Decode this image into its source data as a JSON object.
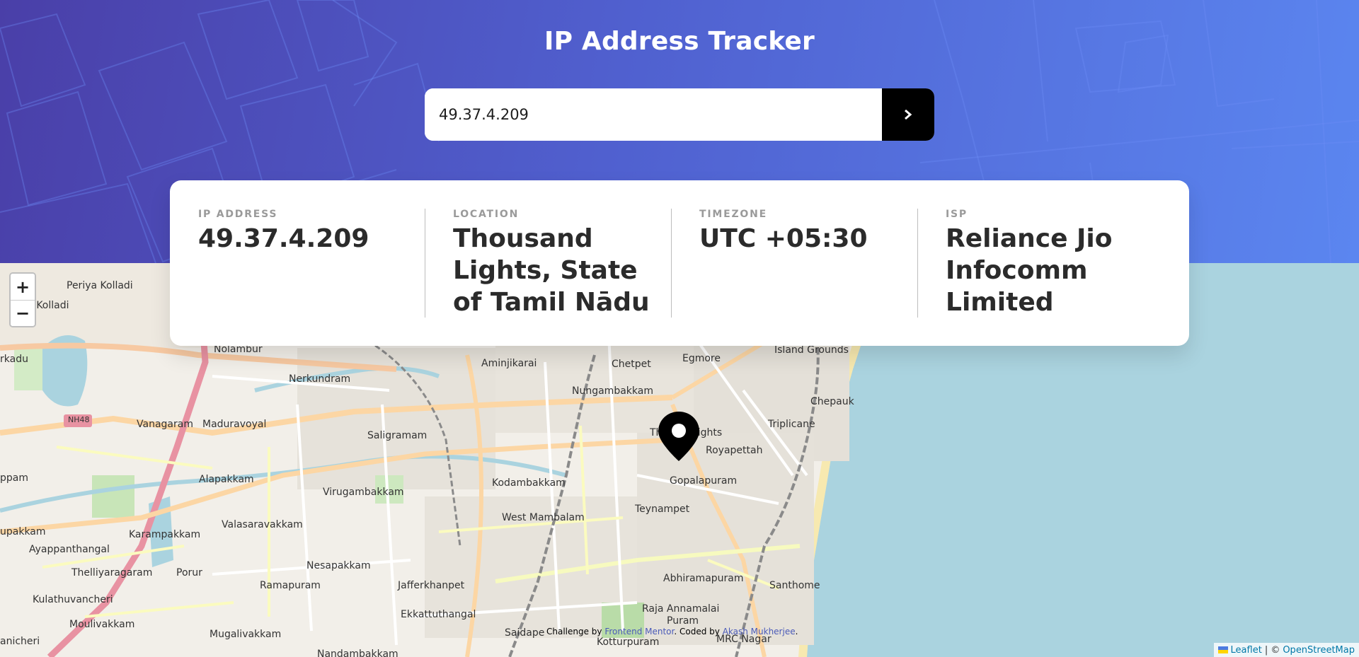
{
  "header": {
    "title": "IP Address Tracker",
    "search_value": "49.37.4.209"
  },
  "info": {
    "ip_label": "IP ADDRESS",
    "ip_value": "49.37.4.209",
    "location_label": "LOCATION",
    "location_value": "Thousand Lights, State of Tamil Nādu",
    "timezone_label": "TIMEZONE",
    "timezone_value": "UTC +05:30",
    "isp_label": "ISP",
    "isp_value": "Reliance Jio Infocomm Limited"
  },
  "map": {
    "zoom_in": "+",
    "zoom_out": "−",
    "labels": {
      "periya_kolladi": "Periya Kolladi",
      "kolladi": "n Kolladi",
      "kadu": "rkadu",
      "nolambur": "Nolambur",
      "nerkundram": "Nerkundram",
      "aminjikarai": "Aminjikarai",
      "chetpet": "Chetpet",
      "egmore": "Egmore",
      "island_grounds": "Island Grounds",
      "chepauk": "Chepauk",
      "vanagaram": "Vanagaram",
      "maduravoyal": "Maduravoyal",
      "nungambakkam": "Nungambakkam",
      "triplicane": "Triplicane",
      "saligramam": "Saligramam",
      "thousand_lights": "Th   sand Lights",
      "royapettah": "Royapettah",
      "alapakkam": "Alapakkam",
      "kodambakkam": "Kodambakkam",
      "gopalapuram": "Gopalapuram",
      "ppam": "ppam",
      "virugambakkam": "Virugambakkam",
      "teynampet": "Teynampet",
      "west_mambalam": "West Mambalam",
      "valasaravakkam": "Valasaravakkam",
      "upakkam": "upakkam",
      "karampakkam": "Karampakkam",
      "ayappanthangal": "Ayappanthangal",
      "thelliyaragaram": "Thelliyaragaram",
      "porur": "Porur",
      "nesapakkam": "Nesapakkam",
      "ramapuram": "Ramapuram",
      "jafferkhanpet": "Jafferkhanpet",
      "abhiramapuram": "Abhiramapuram",
      "santhome": "Santhome",
      "kulathuvancheri": "Kulathuvancheri",
      "moulivakkam": "Moulivakkam",
      "ekkattuthangal": "Ekkattuthangal",
      "raja_annamalai": "Raja Annamalai",
      "puram": "Puram",
      "mugalivakkam": "Mugalivakkam",
      "saidapet": "Saidape",
      "kotturpuram": "Kotturpuram",
      "mrc_nagar": "MRC Nagar",
      "nandambakkam": "Nandambakkam",
      "anicheri": "anicheri",
      "nh48": "NH48"
    }
  },
  "footer": {
    "challenge_by": "Challenge by",
    "frontend_mentor": "Frontend Mentor",
    "coded_by": ". Coded by",
    "author": "Akash Mukherjee",
    "period": ".",
    "leaflet": "Leaflet",
    "separator": "| ©",
    "osm": "OpenStreetMap"
  }
}
